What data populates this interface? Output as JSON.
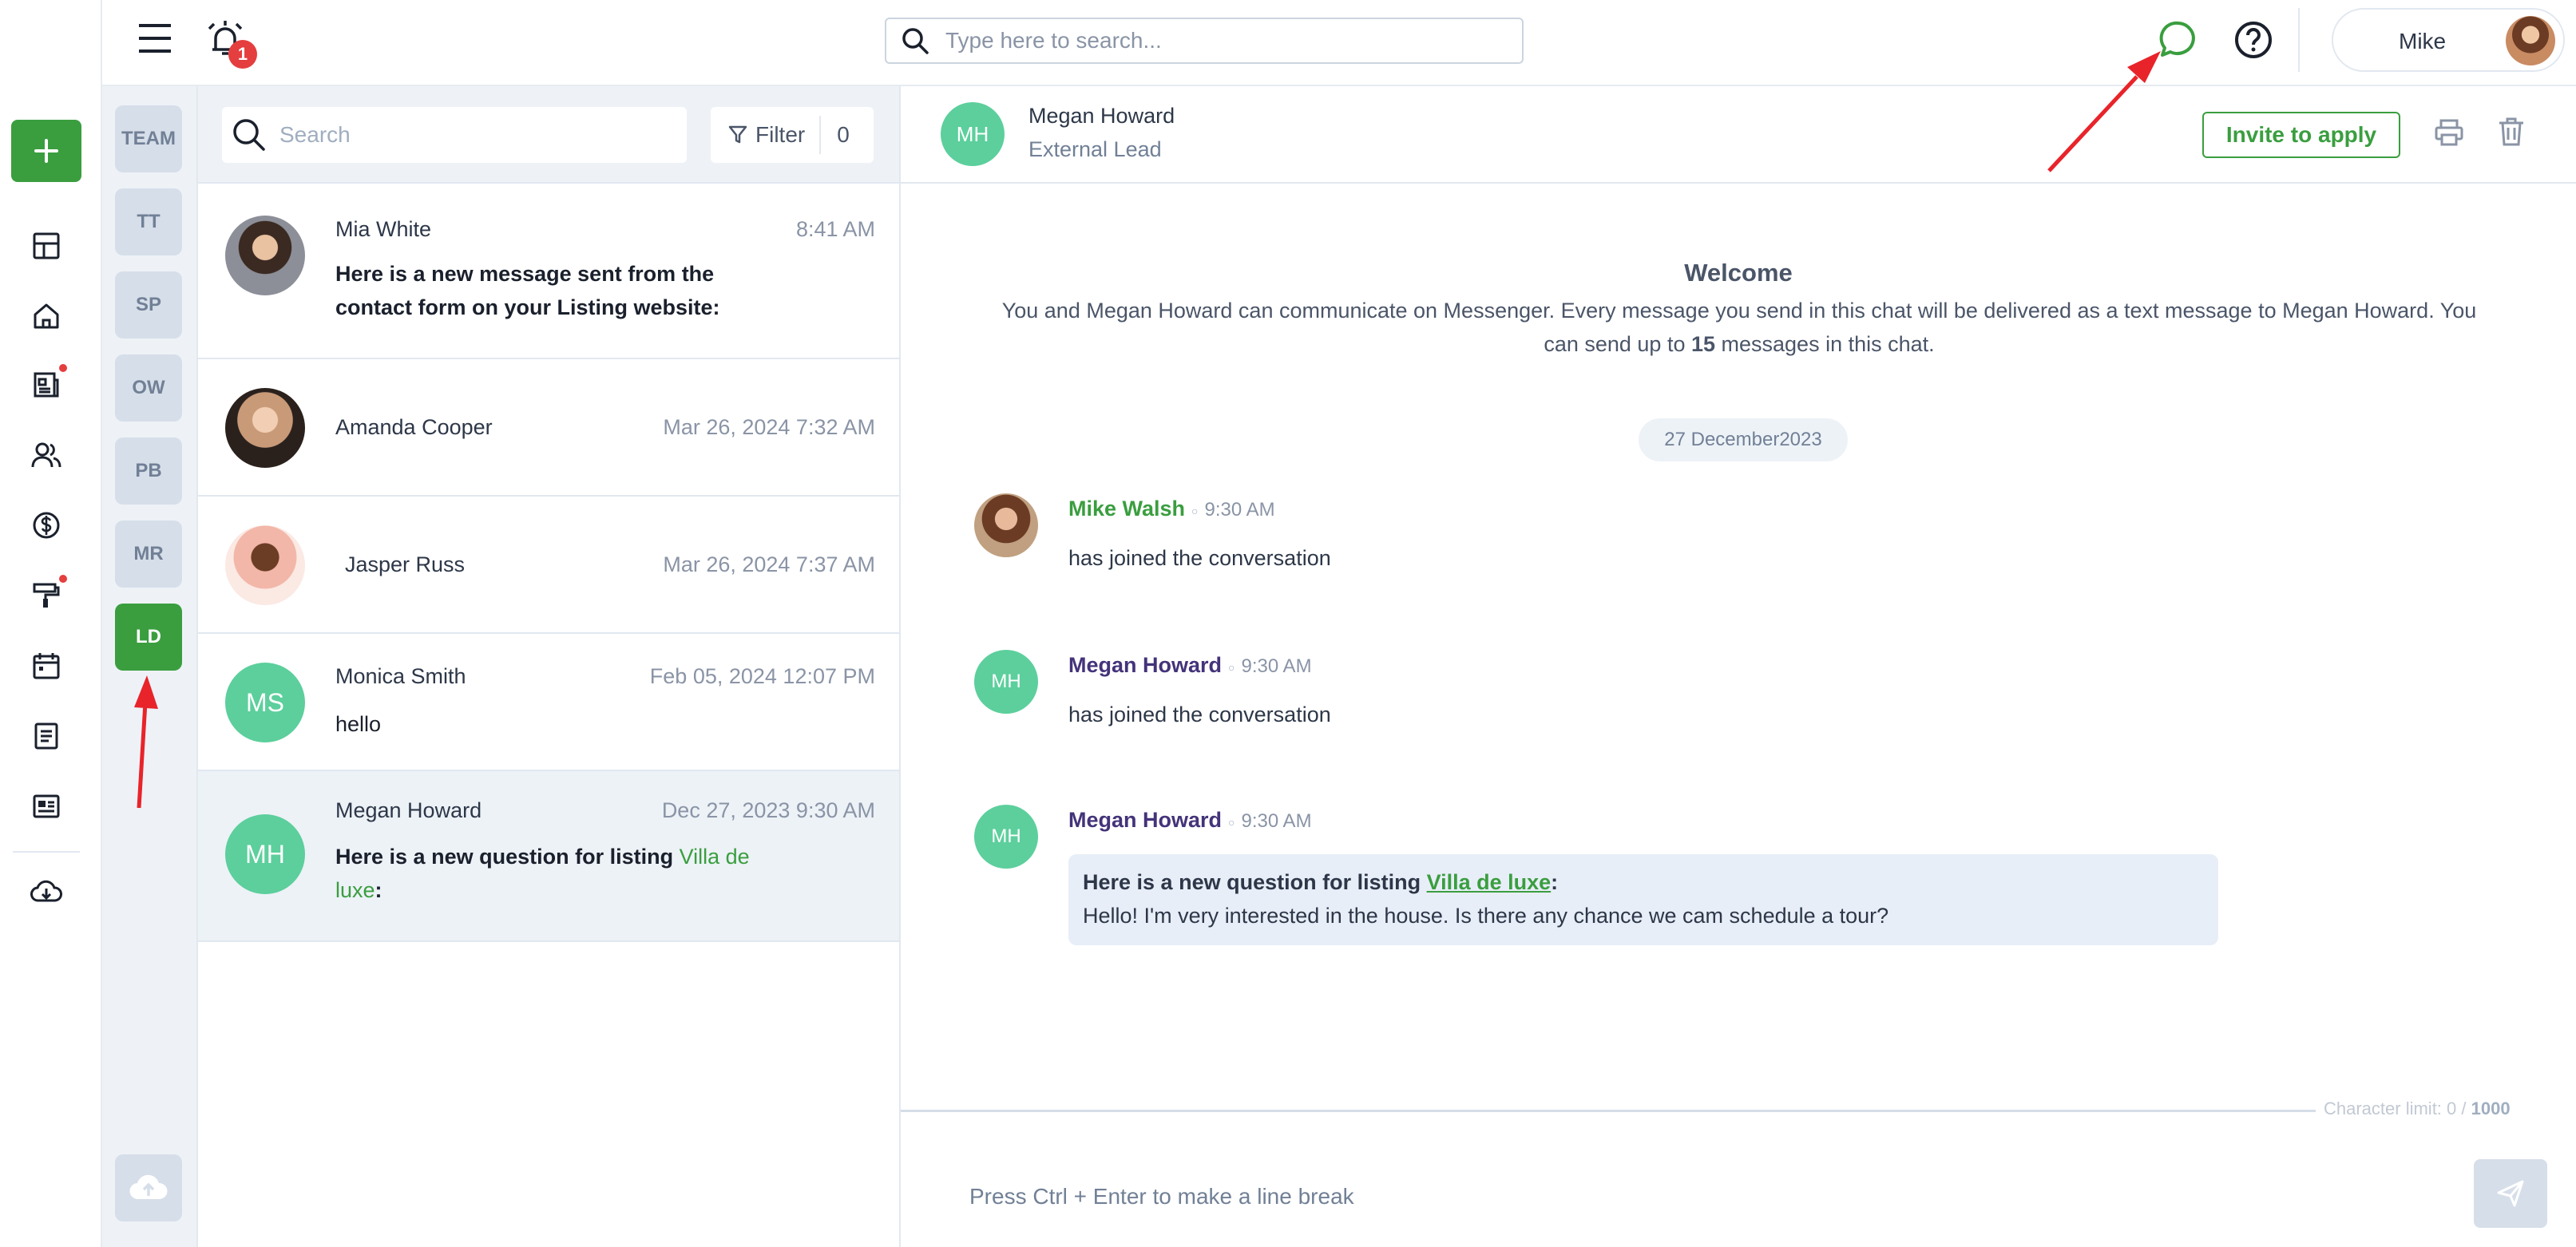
{
  "topbar": {
    "notification_count": "1",
    "search_placeholder": "Type here to search...",
    "user_name": "Mike"
  },
  "teams": [
    "TEAM",
    "TT",
    "SP",
    "OW",
    "PB",
    "MR",
    "LD"
  ],
  "active_team": "LD",
  "list": {
    "search_placeholder": "Search",
    "filter_label": "Filter",
    "filter_count": "0",
    "conversations": [
      {
        "name": "Mia White",
        "time": "8:41 AM",
        "message": "Here is a new message sent from the contact form on your Listing website:"
      },
      {
        "name": "Amanda Cooper",
        "time": "Mar 26, 2024 7:32 AM"
      },
      {
        "name": "Jasper Russ",
        "time": "Mar 26, 2024 7:37 AM"
      },
      {
        "name": "Monica Smith",
        "initials": "MS",
        "time": "Feb 05, 2024 12:07 PM",
        "message": "hello"
      },
      {
        "name": "Megan Howard",
        "initials": "MH",
        "time": "Dec 27, 2023 9:30 AM",
        "message_prefix": "Here is a new question for listing ",
        "message_link": "Villa de luxe",
        "message_suffix": ":"
      }
    ]
  },
  "chat": {
    "contact_initials": "MH",
    "contact_name": "Megan Howard",
    "contact_role": "External Lead",
    "invite_label": "Invite to apply",
    "welcome_title": "Welcome",
    "welcome_line1": "You and Megan Howard can communicate on Messenger. Every message you send in this chat will be delivered as a text message to Megan Howard. You",
    "welcome_line2_prefix": "can send up to ",
    "welcome_limit": "15",
    "welcome_line2_suffix": " messages in this chat.",
    "date_divider": "27 December2023",
    "messages": [
      {
        "author": "Mike Walsh",
        "time": "9:30 AM",
        "body": "has joined the conversation"
      },
      {
        "author": "Megan Howard",
        "initials": "MH",
        "time": "9:30 AM",
        "body": "has joined the conversation"
      },
      {
        "author": "Megan Howard",
        "initials": "MH",
        "time": "9:30 AM",
        "bubble_prefix": "Here is a new question for listing ",
        "bubble_link": "Villa de luxe",
        "bubble_suffix": ":",
        "bubble_line2": "Hello! I'm very interested in the house. Is there any chance we cam schedule a tour?"
      }
    ],
    "char_limit_prefix": "Character limit: 0 / ",
    "char_limit_max": "1000",
    "compose_placeholder": "Press Ctrl + Enter to make a line break"
  },
  "colors": {
    "brand_green": "#3a9e3f",
    "avatar_teal": "#5ccf9c",
    "alert_red": "#e53e3e",
    "annotation_arrow": "#e8242a"
  },
  "icons": [
    "plus-icon",
    "dashboard-icon",
    "home-icon",
    "listings-icon",
    "contacts-icon",
    "dollar-icon",
    "paint-roller-icon",
    "calendar-icon",
    "document-icon",
    "news-icon",
    "cloud-download-icon",
    "menu-icon",
    "alarm-bell-icon",
    "search-icon",
    "chat-bubble-icon",
    "help-icon",
    "filter-icon",
    "upload-cloud-icon",
    "print-icon",
    "trash-icon",
    "send-icon"
  ]
}
